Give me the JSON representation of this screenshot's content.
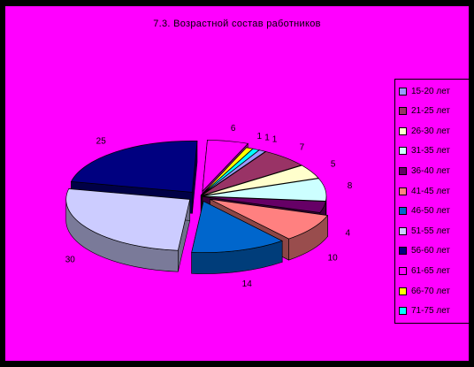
{
  "chart_data": {
    "type": "pie",
    "style": "3d-exploded",
    "title": "7.3. Возрастной состав работников",
    "categories": [
      "15-20 лет",
      "21-25 лет",
      "26-30 лет",
      "31-35 лет",
      "36-40 лет",
      "41-45 лет",
      "46-50 лет",
      "51-55 лет",
      "56-60 лет",
      "61-65 лет",
      "66-70 лет",
      "71-75 лет"
    ],
    "values": [
      1,
      7,
      5,
      8,
      4,
      10,
      14,
      30,
      25,
      6,
      1,
      1
    ],
    "colors": [
      "#9999ff",
      "#993366",
      "#ffffcc",
      "#ccffff",
      "#660066",
      "#ff8080",
      "#0066cc",
      "#ccccff",
      "#000080",
      "#ff00ff",
      "#ffff00",
      "#00ffff"
    ],
    "legend": "right"
  },
  "background_color": "#ff00ff",
  "frame_color": "#000000"
}
